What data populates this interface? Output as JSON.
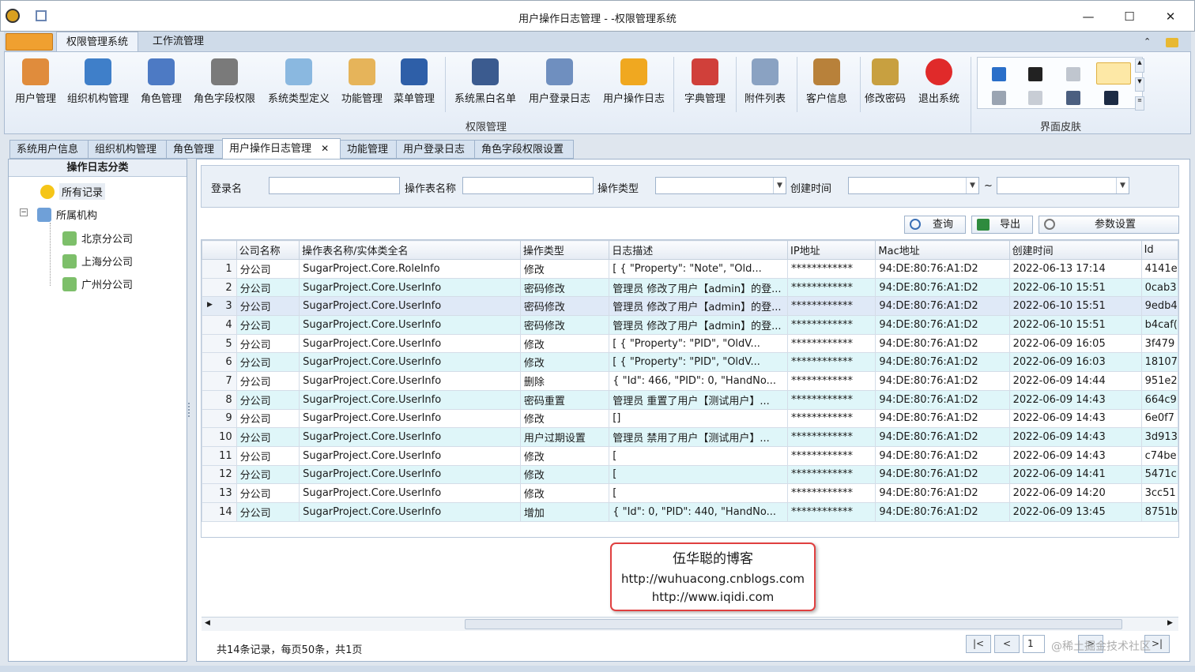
{
  "window": {
    "title": "用户操作日志管理 - -权限管理系统",
    "min": "—",
    "max": "☐",
    "close": "✕"
  },
  "ribbon_tabs": [
    "权限管理系统",
    "工作流管理"
  ],
  "ribbon_buttons": [
    "用户管理",
    "组织机构管理",
    "角色管理",
    "角色字段权限",
    "系统类型定义",
    "功能管理",
    "菜单管理",
    "系统黑白名单",
    "用户登录日志",
    "用户操作日志",
    "字典管理",
    "附件列表",
    "客户信息",
    "修改密码",
    "退出系统"
  ],
  "ribbon_groups": {
    "main": "权限管理",
    "skin": "界面皮肤"
  },
  "doc_tabs": [
    "系统用户信息",
    "组织机构管理",
    "角色管理",
    "用户操作日志管理",
    "功能管理",
    "用户登录日志",
    "角色字段权限设置"
  ],
  "tab_close": "✕",
  "left": {
    "header": "操作日志分类",
    "root": "所有记录",
    "org": "所属机构",
    "branches": [
      "北京分公司",
      "上海分公司",
      "广州分公司"
    ],
    "expander": "−"
  },
  "filter": {
    "login_label": "登录名",
    "table_label": "操作表名称",
    "type_label": "操作类型",
    "time_label": "创建时间",
    "tilde": "~"
  },
  "toolbar": {
    "query": "查询",
    "export": "导出",
    "settings": "参数设置"
  },
  "grid": {
    "columns": [
      "公司名称",
      "操作表名称/实体类全名",
      "操作类型",
      "日志描述",
      "IP地址",
      "Mac地址",
      "创建时间",
      "Id"
    ],
    "rows": [
      [
        "1",
        "分公司",
        "SugarProject.Core.RoleInfo",
        "修改",
        "[ {   \"Property\": \"Note\",    \"Old...",
        "************",
        "94:DE:80:76:A1:D2",
        "2022-06-13 17:14",
        "4141e"
      ],
      [
        "2",
        "分公司",
        "SugarProject.Core.UserInfo",
        "密码修改",
        "管理员 修改了用户【admin】的登...",
        "************",
        "94:DE:80:76:A1:D2",
        "2022-06-10 15:51",
        "0cab3"
      ],
      [
        "3",
        "分公司",
        "SugarProject.Core.UserInfo",
        "密码修改",
        "管理员 修改了用户【admin】的登...",
        "************",
        "94:DE:80:76:A1:D2",
        "2022-06-10 15:51",
        "9edb4"
      ],
      [
        "4",
        "分公司",
        "SugarProject.Core.UserInfo",
        "密码修改",
        "管理员 修改了用户【admin】的登...",
        "************",
        "94:DE:80:76:A1:D2",
        "2022-06-10 15:51",
        "b4caf("
      ],
      [
        "5",
        "分公司",
        "SugarProject.Core.UserInfo",
        "修改",
        "[ {   \"Property\": \"PID\",    \"OldV...",
        "************",
        "94:DE:80:76:A1:D2",
        "2022-06-09 16:05",
        "3f479"
      ],
      [
        "6",
        "分公司",
        "SugarProject.Core.UserInfo",
        "修改",
        "[ {   \"Property\": \"PID\",    \"OldV...",
        "************",
        "94:DE:80:76:A1:D2",
        "2022-06-09 16:03",
        "18107"
      ],
      [
        "7",
        "分公司",
        "SugarProject.Core.UserInfo",
        "删除",
        "{  \"Id\": 466,  \"PID\": 0,  \"HandNo...",
        "************",
        "94:DE:80:76:A1:D2",
        "2022-06-09 14:44",
        "951e2"
      ],
      [
        "8",
        "分公司",
        "SugarProject.Core.UserInfo",
        "密码重置",
        "管理员 重置了用户【测试用户】...",
        "************",
        "94:DE:80:76:A1:D2",
        "2022-06-09 14:43",
        "664c9"
      ],
      [
        "9",
        "分公司",
        "SugarProject.Core.UserInfo",
        "修改",
        "[]",
        "************",
        "94:DE:80:76:A1:D2",
        "2022-06-09 14:43",
        "6e0f7"
      ],
      [
        "10",
        "分公司",
        "SugarProject.Core.UserInfo",
        "用户过期设置",
        "管理员 禁用了用户【测试用户】...",
        "************",
        "94:DE:80:76:A1:D2",
        "2022-06-09 14:43",
        "3d913"
      ],
      [
        "11",
        "分公司",
        "SugarProject.Core.UserInfo",
        "修改",
        "[",
        "************",
        "94:DE:80:76:A1:D2",
        "2022-06-09 14:43",
        "c74be"
      ],
      [
        "12",
        "分公司",
        "SugarProject.Core.UserInfo",
        "修改",
        "[",
        "************",
        "94:DE:80:76:A1:D2",
        "2022-06-09 14:41",
        "5471c"
      ],
      [
        "13",
        "分公司",
        "SugarProject.Core.UserInfo",
        "修改",
        "[",
        "************",
        "94:DE:80:76:A1:D2",
        "2022-06-09 14:20",
        "3cc51"
      ],
      [
        "14",
        "分公司",
        "SugarProject.Core.UserInfo",
        "增加",
        "{  \"Id\": 0,  \"PID\": 440,  \"HandNo...",
        "************",
        "94:DE:80:76:A1:D2",
        "2022-06-09 13:45",
        "8751b"
      ]
    ]
  },
  "watermark": {
    "title": "伍华聪的博客",
    "url1": "http://wuhuacong.cnblogs.com",
    "url2": "http://www.iqidi.com"
  },
  "status": {
    "text": "共14条记录，每页50条，共1页",
    "page": "1",
    "corner_mark": "@稀土掘金技术社区"
  },
  "pager": {
    "first": "|<",
    "prev": "<",
    "next": ">",
    "last": ">|"
  }
}
